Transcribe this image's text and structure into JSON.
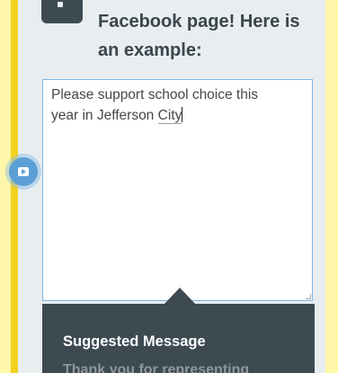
{
  "instruction": {
    "line1": "Facebook page! Here is",
    "line2": "an example:"
  },
  "message": {
    "line1": "Please support school choice this",
    "line2_prefix": "year in Jefferson ",
    "line2_last_word": "City"
  },
  "suggested": {
    "title": "Suggested Message",
    "body": "Thank you for representing"
  },
  "icons": {
    "video_button": "video-play-icon"
  },
  "colors": {
    "accent_yellow": "#f2d11e",
    "page_background": "#fef6a8",
    "panel": "#e8edf0",
    "dark": "#3d4a52",
    "focus_border": "#7fb7e3",
    "video_button": "#5b9fd6"
  }
}
